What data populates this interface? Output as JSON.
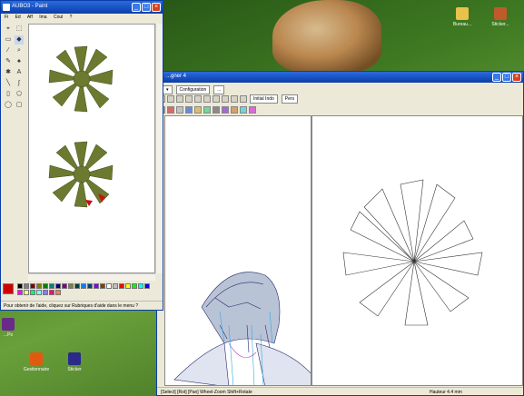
{
  "desktop": {
    "icons": [
      {
        "label": "Bureau...",
        "color": "#e8c24a"
      },
      {
        "label": "Sticker...",
        "color": "#c05a2a"
      },
      {
        "label": "...Ps",
        "color": "#6a2a8a"
      },
      {
        "label": "Gestionnaire",
        "color": "#e05a10"
      },
      {
        "label": "Sticker",
        "color": "#2a2a8a"
      }
    ]
  },
  "paint": {
    "title": "AUBO3 - Paint",
    "menu": [
      "Fi",
      "Ed",
      "Aff",
      "Ima",
      "Coul",
      "?"
    ],
    "status": "Pour obtenir de l'aide, cliquez sur Rubriques d'aide dans le menu ?"
  },
  "designer": {
    "title": "...gner 4",
    "toolbar1": [
      "Configuration",
      "..."
    ],
    "toolbar2": [
      "Initial Indo",
      "Pers"
    ],
    "status_left": "[Select] [Rot] [Pan] Wheel-Zoom Shift+Rotate",
    "status_right": "Hauteur 4.4 mm"
  },
  "palette_colors": [
    "#000000",
    "#808080",
    "#800000",
    "#808000",
    "#008000",
    "#008080",
    "#000080",
    "#800080",
    "#808040",
    "#004040",
    "#0080ff",
    "#004080",
    "#8000ff",
    "#804000",
    "#ffffff",
    "#c0c0c0",
    "#ff0000",
    "#ffff00",
    "#00ff00",
    "#00ffff",
    "#0000ff",
    "#ff00ff",
    "#ffff80",
    "#00ff80",
    "#80ffff",
    "#8080ff",
    "#ff0080",
    "#ff8040"
  ]
}
